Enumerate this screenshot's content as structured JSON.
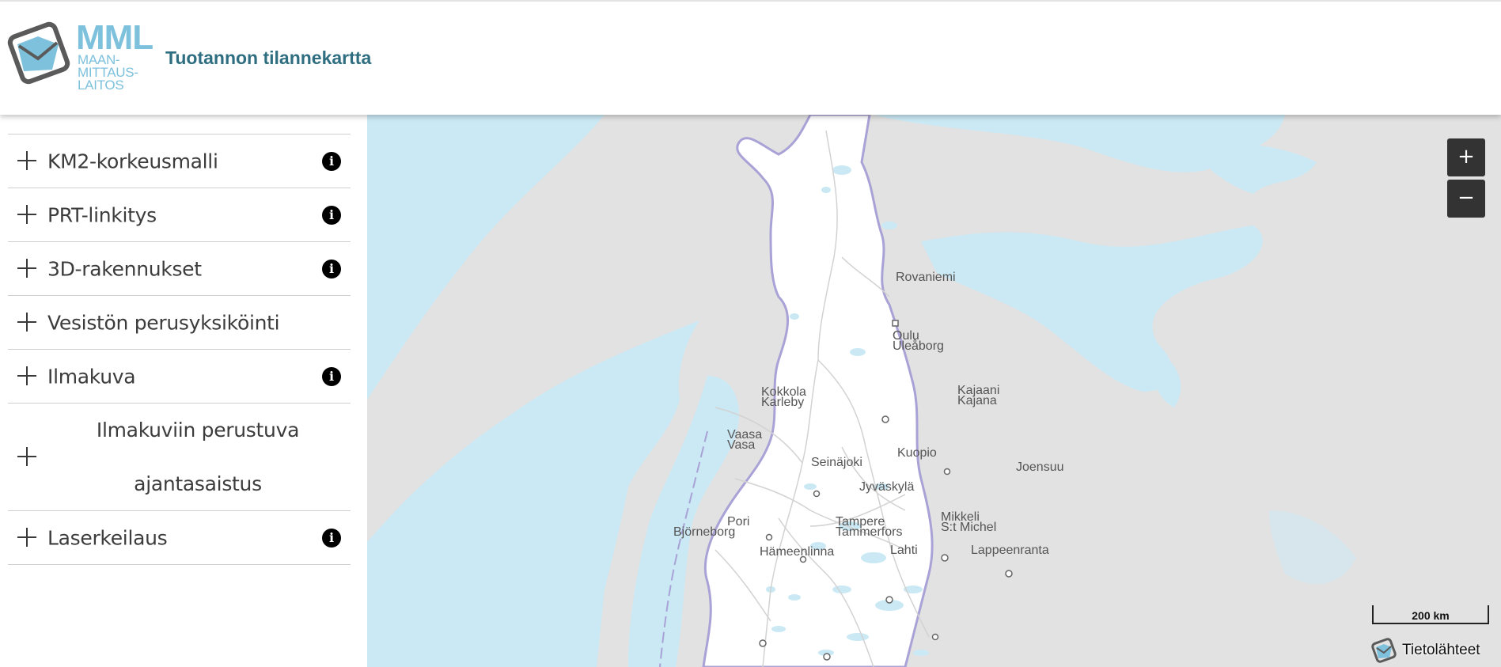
{
  "header": {
    "logo_abbr": "MML",
    "logo_lines": [
      "MAAN-",
      "MITTAUS-",
      "LAITOS"
    ],
    "title": "Tuotannon tilannekartta"
  },
  "sidebar": {
    "items": [
      {
        "label": "KM2-korkeusmalli",
        "info": true
      },
      {
        "label": "PRT-linkitys",
        "info": true
      },
      {
        "label": "3D-rakennukset",
        "info": true
      },
      {
        "label": "Vesistön perusyksiköinti",
        "info": false
      },
      {
        "label": "Ilmakuva",
        "info": true
      },
      {
        "label": "Ilmakuviin perustuva ajantasaistus",
        "info": false
      },
      {
        "label": "Laserkeilaus",
        "info": true
      }
    ],
    "info_glyph": "i"
  },
  "map": {
    "zoom_in": "+",
    "zoom_out": "−",
    "scale": "200 km",
    "sources": "Tietolähteet",
    "places": {
      "rovaniemi": "Rovaniemi",
      "oulu": "Oulu",
      "uleaborg": "Uleåborg",
      "kokkola": "Kokkola",
      "karleby": "Karleby",
      "kajaani": "Kajaani",
      "kajana": "Kajana",
      "vaasa": "Vaasa",
      "vasa": "Vasa",
      "seinajoki": "Seinäjoki",
      "kuopio": "Kuopio",
      "joensuu": "Joensuu",
      "jyvaskyla": "Jyväskylä",
      "pori": "Pori",
      "bjorneborg": "Björneborg",
      "tampere": "Tampere",
      "tammerfors": "Tammerfors",
      "mikkeli": "Mikkeli",
      "stmichel": "S:t Michel",
      "hameenlinna": "Hämeenlinna",
      "lahti": "Lahti",
      "lappeenranta": "Lappeenranta"
    },
    "colors": {
      "water": "#cae9f5",
      "land_finland": "#ffffff",
      "land_other": "#e2e2e2",
      "border": "#a9a2d6"
    }
  }
}
